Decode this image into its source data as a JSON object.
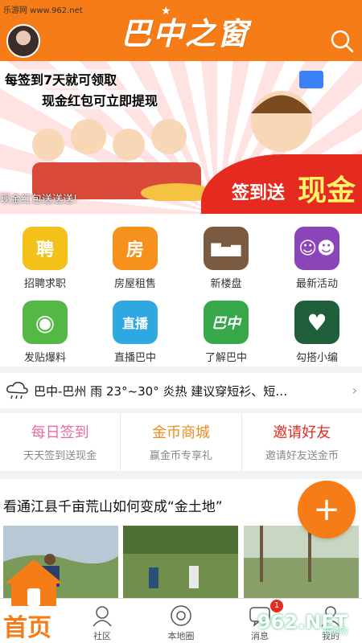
{
  "watermark": {
    "top": "乐游网 www.962.net",
    "brand": "962",
    "brand_suffix": ".NET",
    "brand_sub": "乐游网"
  },
  "header": {
    "logo": "巴中之窗",
    "search_icon": "search-icon"
  },
  "banner": {
    "line1": "每签到7天就可领取",
    "line2": "现金红包可立即提现",
    "caption": "现金红包送送送!",
    "cta_small": "签到送",
    "cta_big": "现金"
  },
  "grid": [
    {
      "label": "招聘求职",
      "glyph": "聘",
      "color": "#f4c11a"
    },
    {
      "label": "房屋租售",
      "glyph": "房",
      "color": "#f5911c"
    },
    {
      "label": "新楼盘",
      "glyph": "▇▅▆",
      "color": "#7a5a40"
    },
    {
      "label": "最新活动",
      "glyph": "☺☻",
      "color": "#8b45b8"
    },
    {
      "label": "发贴爆料",
      "glyph": "◉",
      "color": "#54b845"
    },
    {
      "label": "直播巴中",
      "glyph": "直播",
      "color": "#2fa7e0"
    },
    {
      "label": "了解巴中",
      "glyph": "巴中",
      "color": "#36a84a"
    },
    {
      "label": "勾搭小编",
      "glyph": "♥",
      "color": "#1f5f3a"
    }
  ],
  "weather": {
    "text": "巴中-巴州 雨 23°~30° 炎热 建议穿短衫、短…",
    "arrow": "›"
  },
  "actions": [
    {
      "title": "每日签到",
      "sub": "天天签到送现金",
      "color": "#e86aa0"
    },
    {
      "title": "金币商城",
      "sub": "赢金币专享礼",
      "color": "#f08b1c"
    },
    {
      "title": "邀请好友",
      "sub": "邀请好友送金币",
      "color": "#e52a20"
    }
  ],
  "article": {
    "title": "看通江县千亩荒山如何变成“金土地”"
  },
  "fab": {
    "label": "+"
  },
  "tabbar": {
    "home": "首页",
    "community": "社区",
    "map": "本地圈",
    "messages": "消息",
    "mine": "我的",
    "badge": "1"
  }
}
